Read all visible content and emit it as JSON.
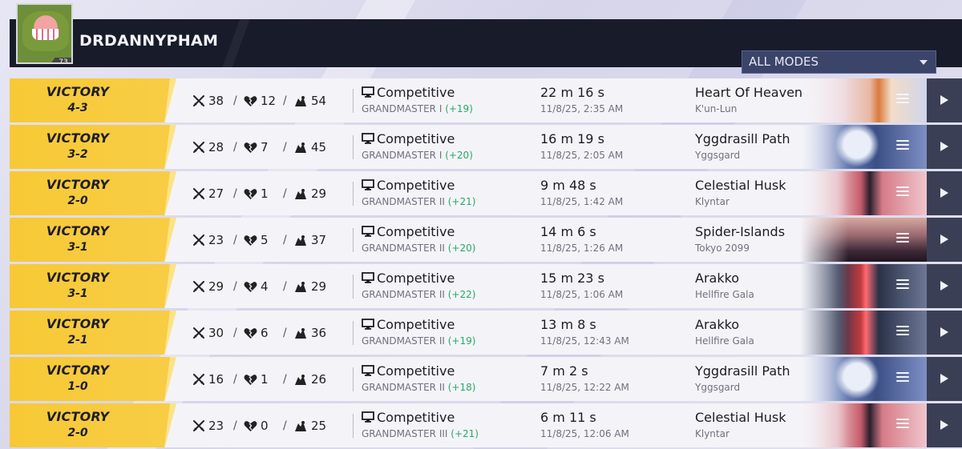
{
  "profile": {
    "username": "DRDANNYPHAM",
    "level": "73"
  },
  "filter": {
    "mode_label": "ALL MODES"
  },
  "colors": {
    "victory": "#f7c936",
    "rank_delta": "#28a868",
    "header_bg": "#181b2a",
    "dropdown_bg": "#3b4469"
  },
  "icons": {
    "kills": "crossed-swords-icon",
    "deaths": "broken-heart-icon",
    "assists": "assist-hand-icon",
    "mode": "monitor-icon",
    "details": "menu-icon",
    "replay": "play-icon"
  },
  "matches": [
    {
      "result": "VICTORY",
      "score": "4-3",
      "kills": "38",
      "deaths": "12",
      "assists": "54",
      "mode": "Competitive",
      "rank": "GRANDMASTER I",
      "delta": "(+19)",
      "duration": "22 m 16 s",
      "date": "11/8/25, 2:35 AM",
      "map": "Heart Of Heaven",
      "region": "K'un-Lun",
      "art": "heart"
    },
    {
      "result": "VICTORY",
      "score": "3-2",
      "kills": "28",
      "deaths": "7",
      "assists": "45",
      "mode": "Competitive",
      "rank": "GRANDMASTER I",
      "delta": "(+20)",
      "duration": "16 m 19 s",
      "date": "11/8/25, 2:05 AM",
      "map": "Yggdrasill Path",
      "region": "Yggsgard",
      "art": "ygg"
    },
    {
      "result": "VICTORY",
      "score": "2-0",
      "kills": "27",
      "deaths": "1",
      "assists": "29",
      "mode": "Competitive",
      "rank": "GRANDMASTER II",
      "delta": "(+21)",
      "duration": "9 m 48 s",
      "date": "11/8/25, 1:42 AM",
      "map": "Celestial Husk",
      "region": "Klyntar",
      "art": "husk"
    },
    {
      "result": "VICTORY",
      "score": "3-1",
      "kills": "23",
      "deaths": "5",
      "assists": "37",
      "mode": "Competitive",
      "rank": "GRANDMASTER II",
      "delta": "(+20)",
      "duration": "14 m 6 s",
      "date": "11/8/25, 1:26 AM",
      "map": "Spider-Islands",
      "region": "Tokyo 2099",
      "art": "spider"
    },
    {
      "result": "VICTORY",
      "score": "3-1",
      "kills": "29",
      "deaths": "4",
      "assists": "29",
      "mode": "Competitive",
      "rank": "GRANDMASTER II",
      "delta": "(+22)",
      "duration": "15 m 23 s",
      "date": "11/8/25, 1:06 AM",
      "map": "Arakko",
      "region": "Hellfire Gala",
      "art": "arakko"
    },
    {
      "result": "VICTORY",
      "score": "2-1",
      "kills": "30",
      "deaths": "6",
      "assists": "36",
      "mode": "Competitive",
      "rank": "GRANDMASTER II",
      "delta": "(+19)",
      "duration": "13 m 8 s",
      "date": "11/8/25, 12:43 AM",
      "map": "Arakko",
      "region": "Hellfire Gala",
      "art": "arakko"
    },
    {
      "result": "VICTORY",
      "score": "1-0",
      "kills": "16",
      "deaths": "1",
      "assists": "26",
      "mode": "Competitive",
      "rank": "GRANDMASTER II",
      "delta": "(+18)",
      "duration": "7 m 2 s",
      "date": "11/8/25, 12:22 AM",
      "map": "Yggdrasill Path",
      "region": "Yggsgard",
      "art": "ygg"
    },
    {
      "result": "VICTORY",
      "score": "2-0",
      "kills": "23",
      "deaths": "0",
      "assists": "25",
      "mode": "Competitive",
      "rank": "GRANDMASTER III",
      "delta": "(+21)",
      "duration": "6 m 11 s",
      "date": "11/8/25, 12:06 AM",
      "map": "Celestial Husk",
      "region": "Klyntar",
      "art": "husk"
    }
  ]
}
